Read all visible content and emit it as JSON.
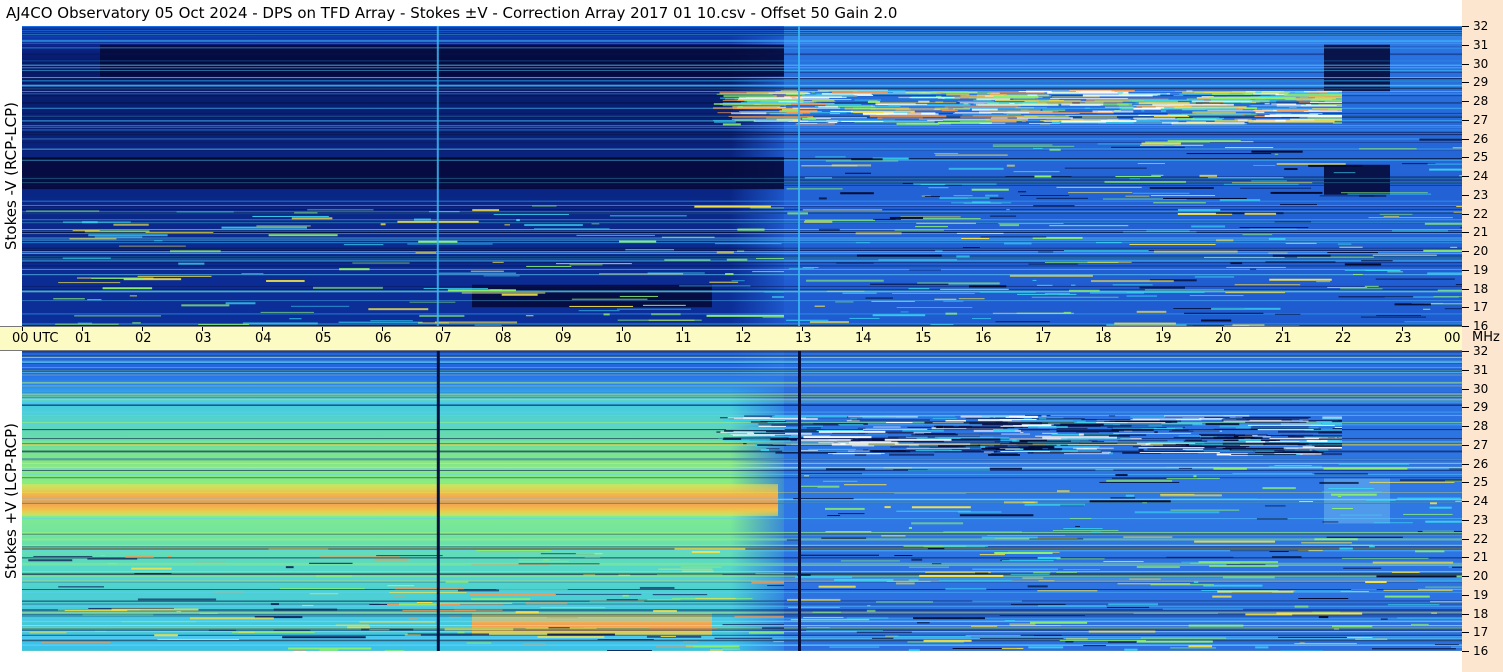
{
  "title": "AJ4CO Observatory  05 Oct 2024  -  DPS on TFD Array  -  Stokes ±V  -  Correction Array 2017 01 10.csv  -  Offset 50  Gain 2.0",
  "panels": [
    {
      "id": "top",
      "ylabel": "Stokes -V (RCP-LCP)",
      "colormap": "jet-dark"
    },
    {
      "id": "bottom",
      "ylabel": "Stokes +V (LCP-RCP)",
      "colormap": "jet-bright"
    }
  ],
  "time_axis": {
    "labels": [
      "00 UTC",
      "01",
      "02",
      "03",
      "04",
      "05",
      "06",
      "07",
      "08",
      "09",
      "10",
      "11",
      "12",
      "13",
      "14",
      "15",
      "16",
      "17",
      "18",
      "19",
      "20",
      "21",
      "22",
      "23",
      "00"
    ],
    "unit": "MHz"
  },
  "freq_axis": {
    "labels": [
      "32",
      "31",
      "30",
      "29",
      "28",
      "27",
      "26",
      "25",
      "24",
      "23",
      "22",
      "21",
      "20",
      "19",
      "18",
      "17",
      "16"
    ]
  },
  "colors": {
    "axis_time_bg": "#fdfbc4",
    "axis_freq_bg": "#fde6cf",
    "deep_navy": "#050a3a",
    "mid_blue": "#1f5fd8",
    "cyan": "#2ec5ee",
    "green": "#8cf070",
    "yellow": "#f5e24a",
    "orange": "#f29a55"
  },
  "chart_data": {
    "type": "heatmap",
    "title": "AJ4CO Observatory  05 Oct 2024  -  DPS on TFD Array  -  Stokes ±V  -  Correction Array 2017 01 10.csv  -  Offset 50  Gain 2.0",
    "x_unit": "UTC hour",
    "y_unit": "MHz",
    "xlim": [
      0,
      24
    ],
    "ylim": [
      16,
      32
    ],
    "series": [
      {
        "name": "Stokes -V (RCP-LCP)",
        "features": [
          {
            "kind": "dark-band",
            "x0": 0,
            "x1": 12.7,
            "y0": 23.3,
            "y1": 25.0
          },
          {
            "kind": "dark-band",
            "x0": 1.3,
            "x1": 12.7,
            "y0": 29.3,
            "y1": 31.0
          },
          {
            "kind": "dark-band",
            "x0": 7.5,
            "x1": 11.5,
            "y0": 17.0,
            "y1": 18.2
          },
          {
            "kind": "dark-band",
            "x0": 21.7,
            "x1": 22.8,
            "y0": 28.5,
            "y1": 31.0
          },
          {
            "kind": "dark-band",
            "x0": 21.7,
            "x1": 22.8,
            "y0": 23.0,
            "y1": 24.6
          },
          {
            "kind": "rfi-speckle",
            "x0": 11.5,
            "x1": 22.0,
            "y0": 26.8,
            "y1": 28.6
          },
          {
            "kind": "vertical-line",
            "x": 6.93
          },
          {
            "kind": "vertical-line",
            "x": 12.95
          }
        ]
      },
      {
        "name": "Stokes +V (LCP-RCP)",
        "features": [
          {
            "kind": "hot-band",
            "x0": 0,
            "x1": 12.6,
            "y0": 23.2,
            "y1": 24.9
          },
          {
            "kind": "hot-band",
            "x0": 7.5,
            "x1": 11.5,
            "y0": 16.8,
            "y1": 18.0
          },
          {
            "kind": "bright-region",
            "x0": 0,
            "x1": 12.7,
            "y0": 16,
            "y1": 30.8
          },
          {
            "kind": "bright-region",
            "x0": 21.7,
            "x1": 22.8,
            "y0": 22.8,
            "y1": 25.2
          },
          {
            "kind": "rfi-speckle",
            "x0": 11.5,
            "x1": 22.0,
            "y0": 26.5,
            "y1": 28.6
          },
          {
            "kind": "vertical-line",
            "x": 6.93
          },
          {
            "kind": "vertical-line",
            "x": 12.95
          }
        ]
      }
    ]
  }
}
